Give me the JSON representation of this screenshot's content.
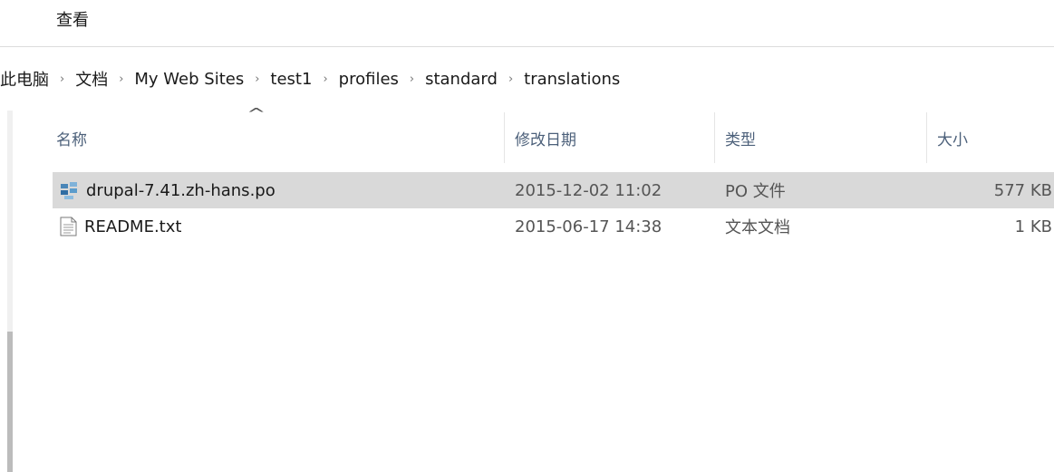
{
  "ribbon": {
    "view_tab": "查看"
  },
  "breadcrumb": [
    "此电脑",
    "文档",
    "My Web Sites",
    "test1",
    "profiles",
    "standard",
    "translations"
  ],
  "columns": {
    "name": "名称",
    "date": "修改日期",
    "type": "类型",
    "size": "大小",
    "sort_indicator": "^"
  },
  "files": [
    {
      "name": "drupal-7.41.zh-hans.po",
      "date": "2015-12-02 11:02",
      "type": "PO 文件",
      "size": "577 KB",
      "icon": "po-file-icon",
      "selected": true
    },
    {
      "name": "README.txt",
      "date": "2015-06-17 14:38",
      "type": "文本文档",
      "size": "1 KB",
      "icon": "text-file-icon",
      "selected": false
    }
  ]
}
